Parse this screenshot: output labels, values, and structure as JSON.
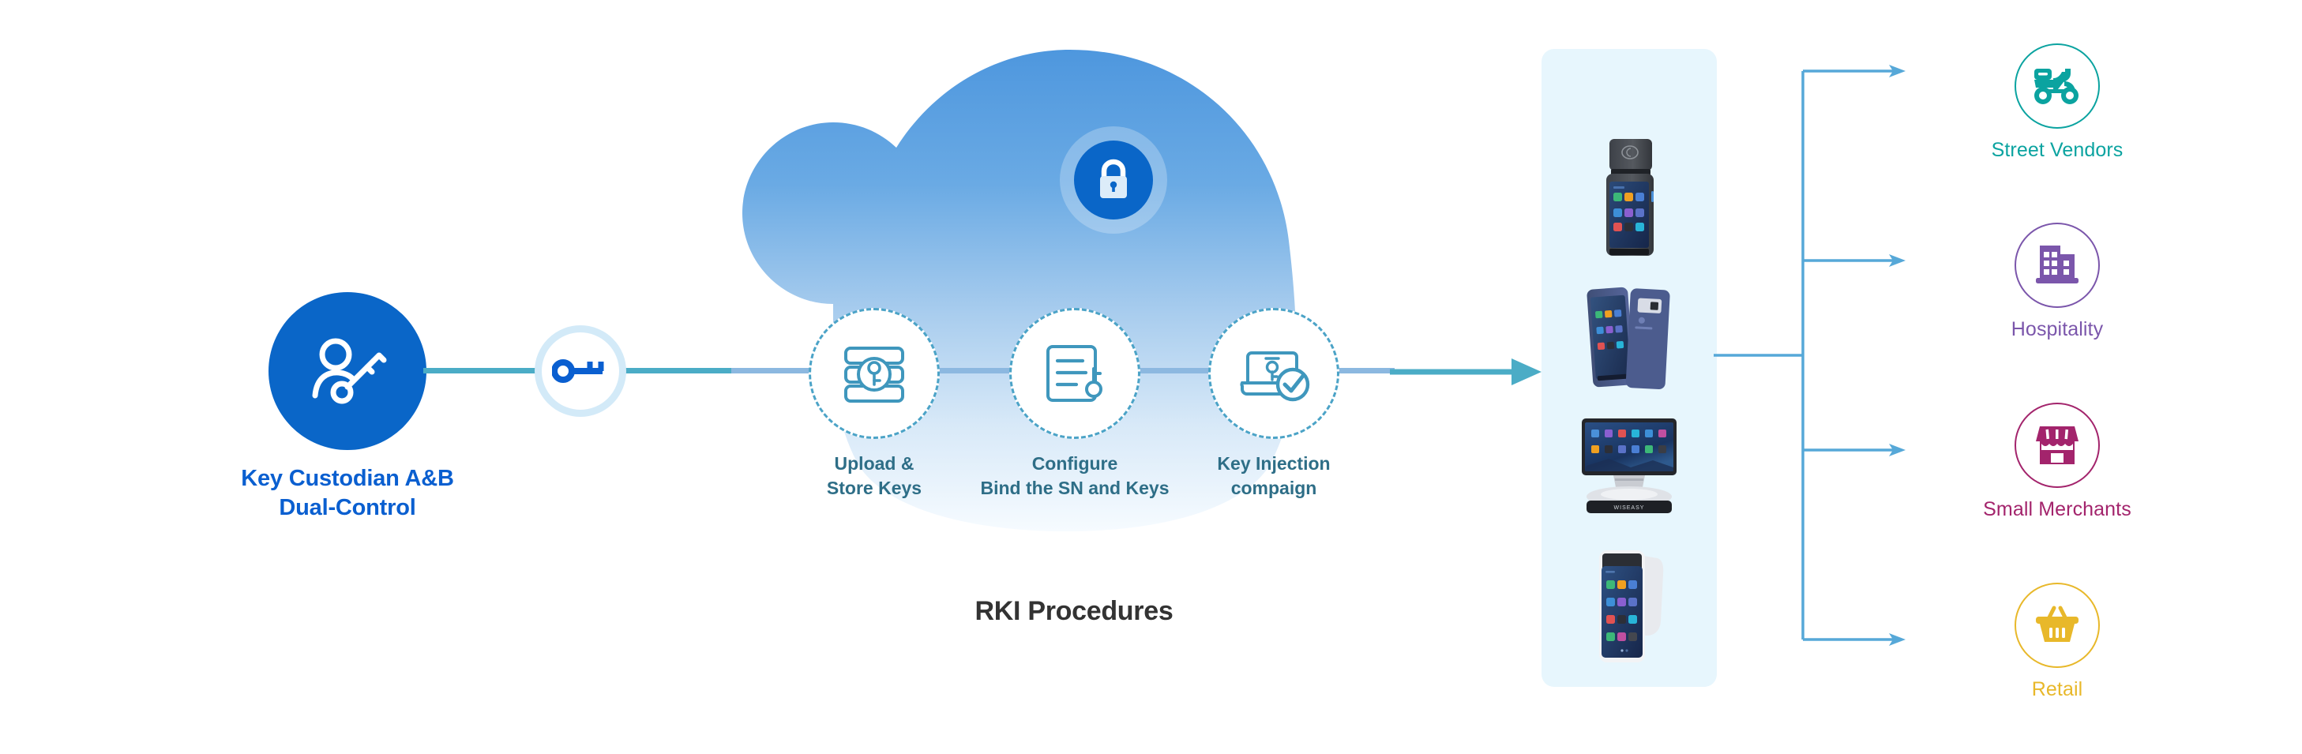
{
  "diagram": {
    "title": "RKI Procedures",
    "source": {
      "label": "Key Custodian A&B\nDual-Control",
      "icon": "user-with-key-icon",
      "color": "#0a5fd0",
      "circle_color": "#0a66c8"
    },
    "key_node": {
      "icon": "key-icon",
      "color": "#0a5fd0",
      "ring_color": "#d3eaf8"
    },
    "cloud": {
      "badge_icon": "padlock-icon",
      "badge_color": "#0a66c8",
      "gradient_top": "#5a9fe0",
      "gradient_bottom": "#f2f9ff",
      "caption": "RKI Procedures",
      "steps": [
        {
          "label": "Upload &\nStore Keys",
          "icon": "server-stack-key-icon"
        },
        {
          "label": "Configure\nBind the SN and Keys",
          "icon": "document-key-icon"
        },
        {
          "label": "Key Injection\ncompaign",
          "icon": "terminal-check-icon"
        }
      ],
      "step_label_color": "#2e6e87",
      "step_border_color": "#4ba3c7"
    },
    "devices": {
      "panel_color": "#e7f6fd",
      "items": [
        {
          "name": "handheld-pos-printer-terminal"
        },
        {
          "name": "mobile-pos-terminal-pair"
        },
        {
          "name": "desktop-pos-display-stand"
        },
        {
          "name": "handheld-pos-white-terminal"
        }
      ]
    },
    "connector": {
      "line_color": "#4bacc6",
      "branch_color": "#56a8d8",
      "cloud_line_color": "#8cb8e0"
    },
    "destinations": [
      {
        "label": "Street Vendors",
        "icon": "scooter-delivery-icon",
        "color": "#0ba3a0"
      },
      {
        "label": "Hospitality",
        "icon": "buildings-icon",
        "color": "#7b56ab"
      },
      {
        "label": "Small Merchants",
        "icon": "storefront-icon",
        "color": "#a3246c"
      },
      {
        "label": "Retail",
        "icon": "shopping-basket-icon",
        "color": "#e8b82a"
      }
    ]
  }
}
